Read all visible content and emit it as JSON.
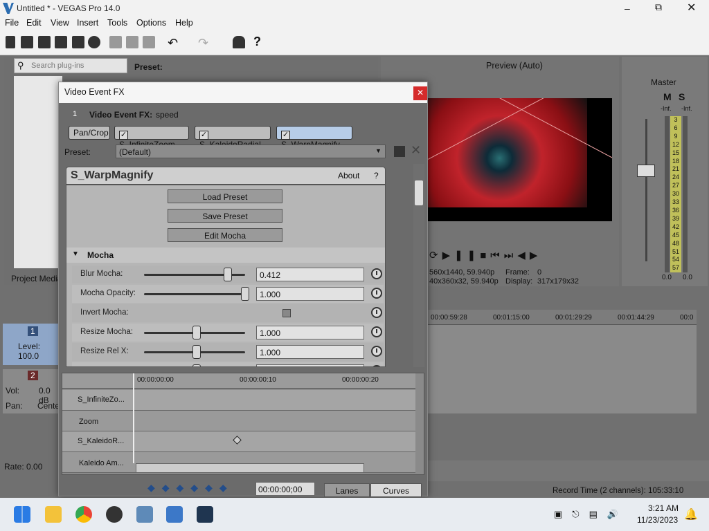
{
  "window": {
    "title": "Untitled * - VEGAS Pro 14.0"
  },
  "menu": [
    "File",
    "Edit",
    "View",
    "Insert",
    "Tools",
    "Options",
    "Help"
  ],
  "left_panel": {
    "search_placeholder": "Search plug-ins",
    "preset_label": "Preset:",
    "tab": "Project Media"
  },
  "track1": {
    "num": "1",
    "level": "Level: 100.0"
  },
  "track2": {
    "num": "2",
    "vol": "Vol:",
    "vol_val": "0.0 dB",
    "pan": "Pan:",
    "pan_val": "Center"
  },
  "rate": "Rate: 0.00",
  "preview": {
    "mode": "Preview (Auto)",
    "frame_label": "Frame:",
    "frame_val": "0",
    "display_label": "Display:",
    "display_val": "317x179x32",
    "res1": "560x1440, 59.940p",
    "res2": "40x360x32, 59.940p"
  },
  "master": {
    "label": "Master",
    "m": "M",
    "s": "S",
    "inf_l": "-Inf.",
    "inf_r": "-Inf.",
    "scale": [
      "3",
      "6",
      "9",
      "12",
      "15",
      "18",
      "21",
      "24",
      "27",
      "30",
      "33",
      "36",
      "39",
      "42",
      "45",
      "48",
      "51",
      "54",
      "57"
    ],
    "foot_l": "0.0",
    "foot_r": "0.0"
  },
  "timeline": {
    "times": [
      "00:00:59:28",
      "00:01:15:00",
      "00:01:29:29",
      "00:01:44:29",
      "00:0"
    ]
  },
  "status": {
    "record": "Record Time (2 channels): 105:33:10"
  },
  "fx": {
    "title": "Video Event FX",
    "chain_num": "1",
    "chain_label": "Video Event FX:",
    "chain_name": "speed",
    "chips": [
      "Pan/Crop",
      "S_InfiniteZoom",
      "S_KaleidoRadial",
      "S_WarpMagnify"
    ],
    "preset_label": "Preset:",
    "preset_value": "(Default)",
    "plugin_name": "S_WarpMagnify",
    "about": "About",
    "help": "?",
    "buttons": [
      "Load Preset",
      "Save Preset",
      "Edit Mocha"
    ],
    "section": "Mocha",
    "params": [
      {
        "label": "Blur Mocha:",
        "value": "0.412",
        "pos": 0.82
      },
      {
        "label": "Mocha Opacity:",
        "value": "1.000",
        "pos": 1.0
      },
      {
        "label": "Invert Mocha:",
        "value": "",
        "pos": -1
      },
      {
        "label": "Resize Mocha:",
        "value": "1.000",
        "pos": 0.5
      },
      {
        "label": "Resize Rel X:",
        "value": "1.000",
        "pos": 0.5
      },
      {
        "label": "Resize Rel Y:",
        "value": "1.000",
        "pos": 0.5
      }
    ],
    "tl_times": [
      "00:00:00:00",
      "00:00:00:10",
      "00:00:00:20"
    ],
    "tl_rows": [
      "S_InfiniteZo...",
      "Zoom",
      "S_KaleidoR...",
      "Kaleido Am..."
    ],
    "time_value": "00:00:00;00",
    "lanes": "Lanes",
    "curves": "Curves"
  },
  "taskbar": {
    "time": "3:21 AM",
    "date": "11/23/2023"
  }
}
